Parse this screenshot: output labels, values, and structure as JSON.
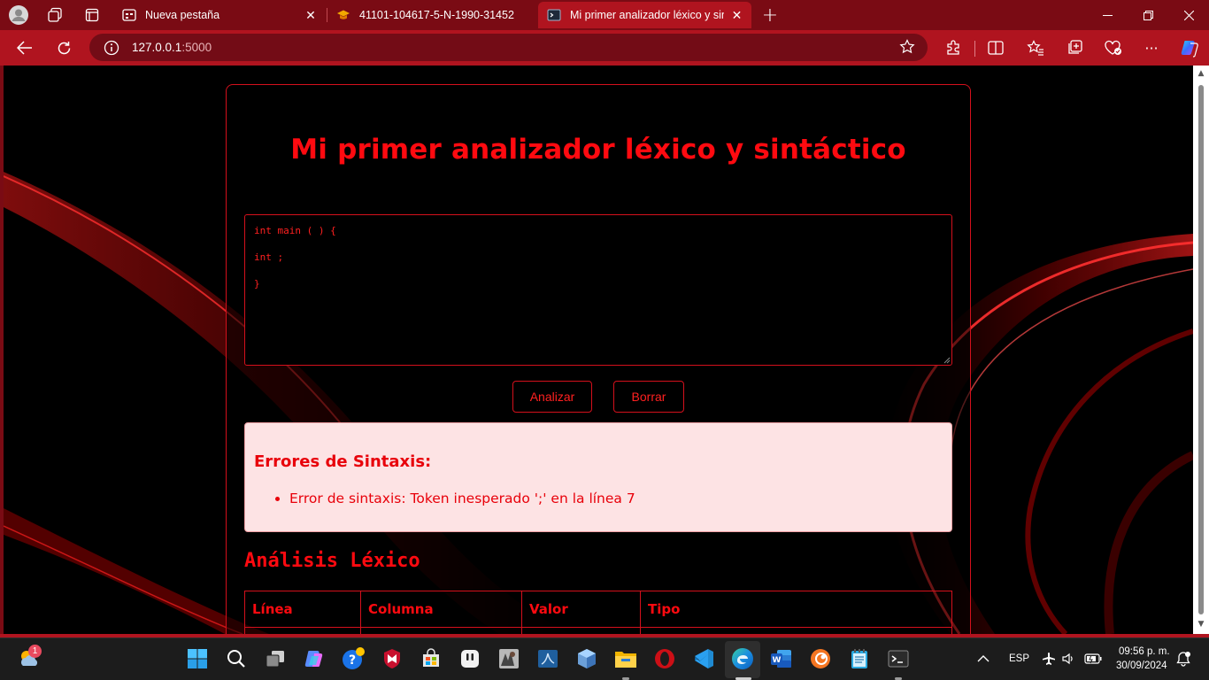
{
  "browser": {
    "tabs": [
      {
        "title": "Nueva pestaña",
        "state": "inactive"
      },
      {
        "title": "41101-104617-5-N-1990-31452",
        "state": "inactive"
      },
      {
        "title": "Mi primer analizador léxico y sintá",
        "state": "active"
      }
    ],
    "address": {
      "host": "127.0.0.1",
      "port": ":5000"
    }
  },
  "page": {
    "title": "Mi primer analizador léxico y sintáctico",
    "code_lines": [
      "int main ( ) {",
      "int ;",
      "}"
    ],
    "buttons": {
      "analyze": "Analizar",
      "clear": "Borrar"
    },
    "errors": {
      "heading": "Errores de Sintaxis:",
      "items": [
        "Error de sintaxis: Token inesperado ';' en la línea 7"
      ]
    },
    "lexical": {
      "heading": "Análisis Léxico",
      "columns": [
        "Línea",
        "Columna",
        "Valor",
        "Tipo"
      ]
    }
  },
  "taskbar": {
    "weather_badge": "1",
    "language": "ESP",
    "time": "09:56 p. m.",
    "date": "30/09/2024"
  },
  "colors": {
    "accent": "#d4101c",
    "text_red": "#ff0a10",
    "chrome": "#b0141f",
    "error_bg": "#fde3e4"
  }
}
